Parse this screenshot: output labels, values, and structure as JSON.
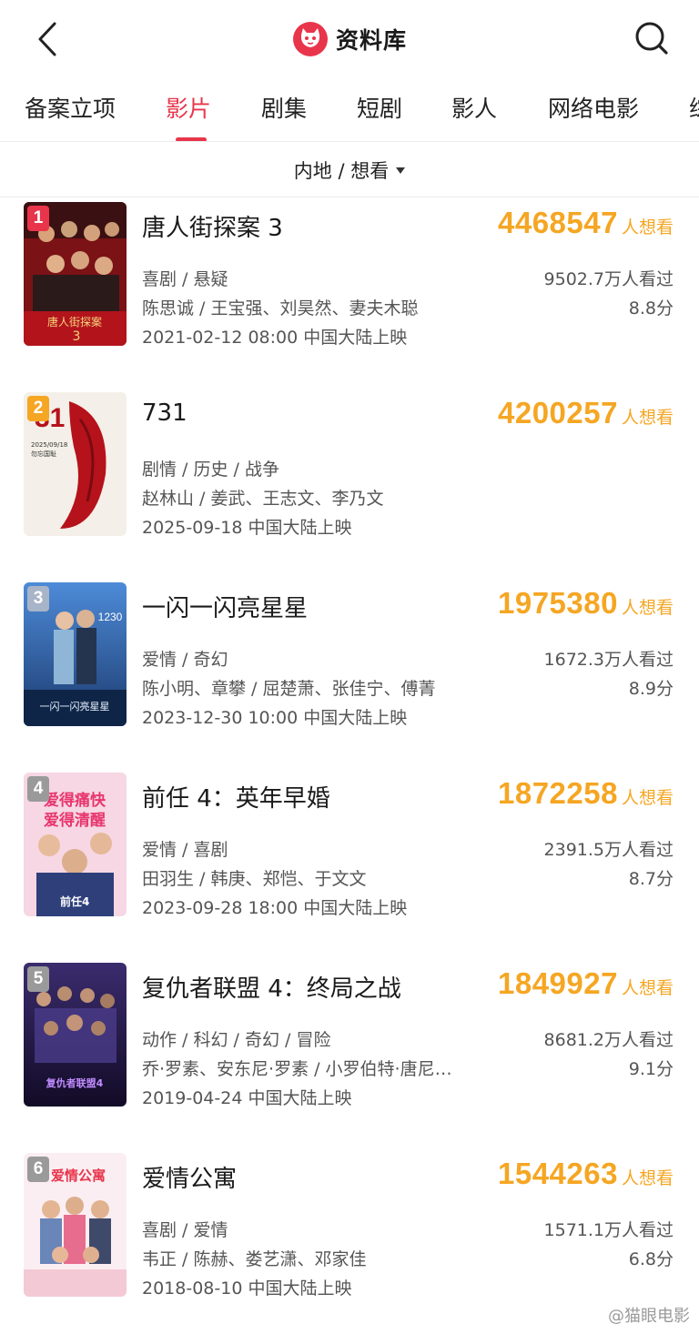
{
  "header": {
    "title": "资料库",
    "back_icon": "chevron-left-icon",
    "search_icon": "search-icon",
    "logo_icon": "maoyan-cat-logo-icon",
    "accent_color": "#e8354b"
  },
  "tabs": [
    {
      "label": "备案立项",
      "active": false
    },
    {
      "label": "影片",
      "active": true
    },
    {
      "label": "剧集",
      "active": false
    },
    {
      "label": "短剧",
      "active": false
    },
    {
      "label": "影人",
      "active": false
    },
    {
      "label": "网络电影",
      "active": false
    },
    {
      "label": "综",
      "active": false
    }
  ],
  "filter": {
    "label": "内地 / 想看"
  },
  "movies": [
    {
      "rank": "1",
      "title": "唐人街探案 3",
      "want_count": "4468547",
      "want_label": "人想看",
      "genres": "喜剧 / 悬疑",
      "cast": "陈思诚 / 王宝强、刘昊然、妻夫木聪",
      "release": "2021-02-12 08:00 中国大陆上映",
      "watched": "9502.7万人看过",
      "score": "8.8分",
      "rank_color": "#e8354b"
    },
    {
      "rank": "2",
      "title": "731",
      "want_count": "4200257",
      "want_label": "人想看",
      "genres": "剧情 / 历史 / 战争",
      "cast": "赵林山 / 姜武、王志文、李乃文",
      "release": "2025-09-18 中国大陆上映",
      "watched": "",
      "score": "",
      "rank_color": "#f5a623"
    },
    {
      "rank": "3",
      "title": "一闪一闪亮星星",
      "want_count": "1975380",
      "want_label": "人想看",
      "genres": "爱情 / 奇幻",
      "cast": "陈小明、章攀 / 屈楚萧、张佳宁、傅菁",
      "release": "2023-12-30 10:00 中国大陆上映",
      "watched": "1672.3万人看过",
      "score": "8.9分",
      "rank_color": "#a8b4c8"
    },
    {
      "rank": "4",
      "title": "前任 4：英年早婚",
      "want_count": "1872258",
      "want_label": "人想看",
      "genres": "爱情 / 喜剧",
      "cast": "田羽生 / 韩庚、郑恺、于文文",
      "release": "2023-09-28 18:00 中国大陆上映",
      "watched": "2391.5万人看过",
      "score": "8.7分",
      "rank_color": "#9a9a9a"
    },
    {
      "rank": "5",
      "title": "复仇者联盟 4：终局之战",
      "want_count": "1849927",
      "want_label": "人想看",
      "genres": "动作 / 科幻 / 奇幻 / 冒险",
      "cast": "乔·罗素、安东尼·罗素 / 小罗伯特·唐尼…",
      "release": "2019-04-24 中国大陆上映",
      "watched": "8681.2万人看过",
      "score": "9.1分",
      "rank_color": "#9a9a9a"
    },
    {
      "rank": "6",
      "title": "爱情公寓",
      "want_count": "1544263",
      "want_label": "人想看",
      "genres": "喜剧 / 爱情",
      "cast": "韦正 / 陈赫、娄艺潇、邓家佳",
      "release": "2018-08-10 中国大陆上映",
      "watched": "1571.1万人看过",
      "score": "6.8分",
      "rank_color": "#9a9a9a"
    }
  ],
  "watermark": "@猫眼电影"
}
